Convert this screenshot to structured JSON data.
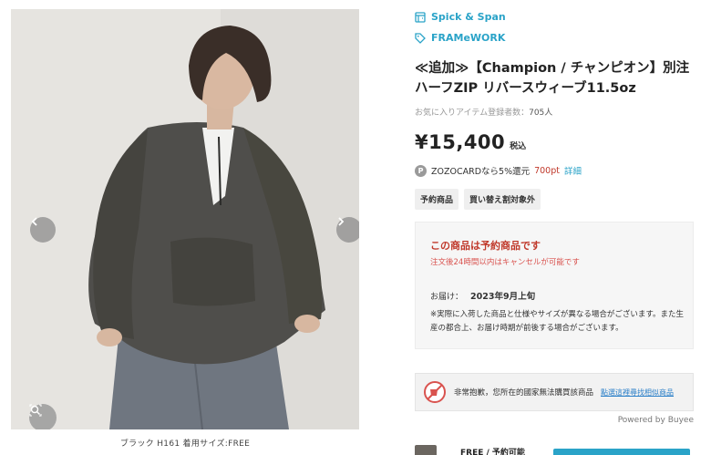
{
  "shop": {
    "name": "Spick & Span",
    "icon": "shop-icon"
  },
  "brand": {
    "name": "FRAMeWORK",
    "icon": "tag-icon"
  },
  "product": {
    "title": "≪追加≫【Champion / チャンピオン】別注ハーフZIP リバースウィーブ11.5oz",
    "favorite_label": "お気に入りアイテム登録者数：",
    "favorite_count": "705人",
    "price": "¥15,400",
    "tax_label": "税込"
  },
  "zozocard": {
    "badge": "P",
    "text": "ZOZOCARDなら5%還元",
    "points": "700pt",
    "detail_link": "詳細"
  },
  "tags": [
    "予約商品",
    "買い替え割対象外"
  ],
  "notice": {
    "heading": "この商品は予約商品です",
    "sub": "注文後24時間以内はキャンセルが可能です",
    "delivery_label": "お届け：",
    "delivery_value": "2023年9月上旬",
    "note": "※実際に入荷した商品と仕様やサイズが異なる場合がございます。また生産の都合上、お届け時期が前後する場合がございます。"
  },
  "buyee": {
    "message": "非常抱歉，您所在的國家無法購買該商品",
    "link": "點選這裡尋找相似商品",
    "powered": "Powered by Buyee"
  },
  "image": {
    "caption": "ブラック H161 着用サイズ:FREE"
  },
  "variant": {
    "size": "FREE / 予約可能"
  },
  "colors": {
    "accent": "#2aa3c8",
    "price_red": "#c0392b",
    "notice_red": "#d9534f"
  }
}
